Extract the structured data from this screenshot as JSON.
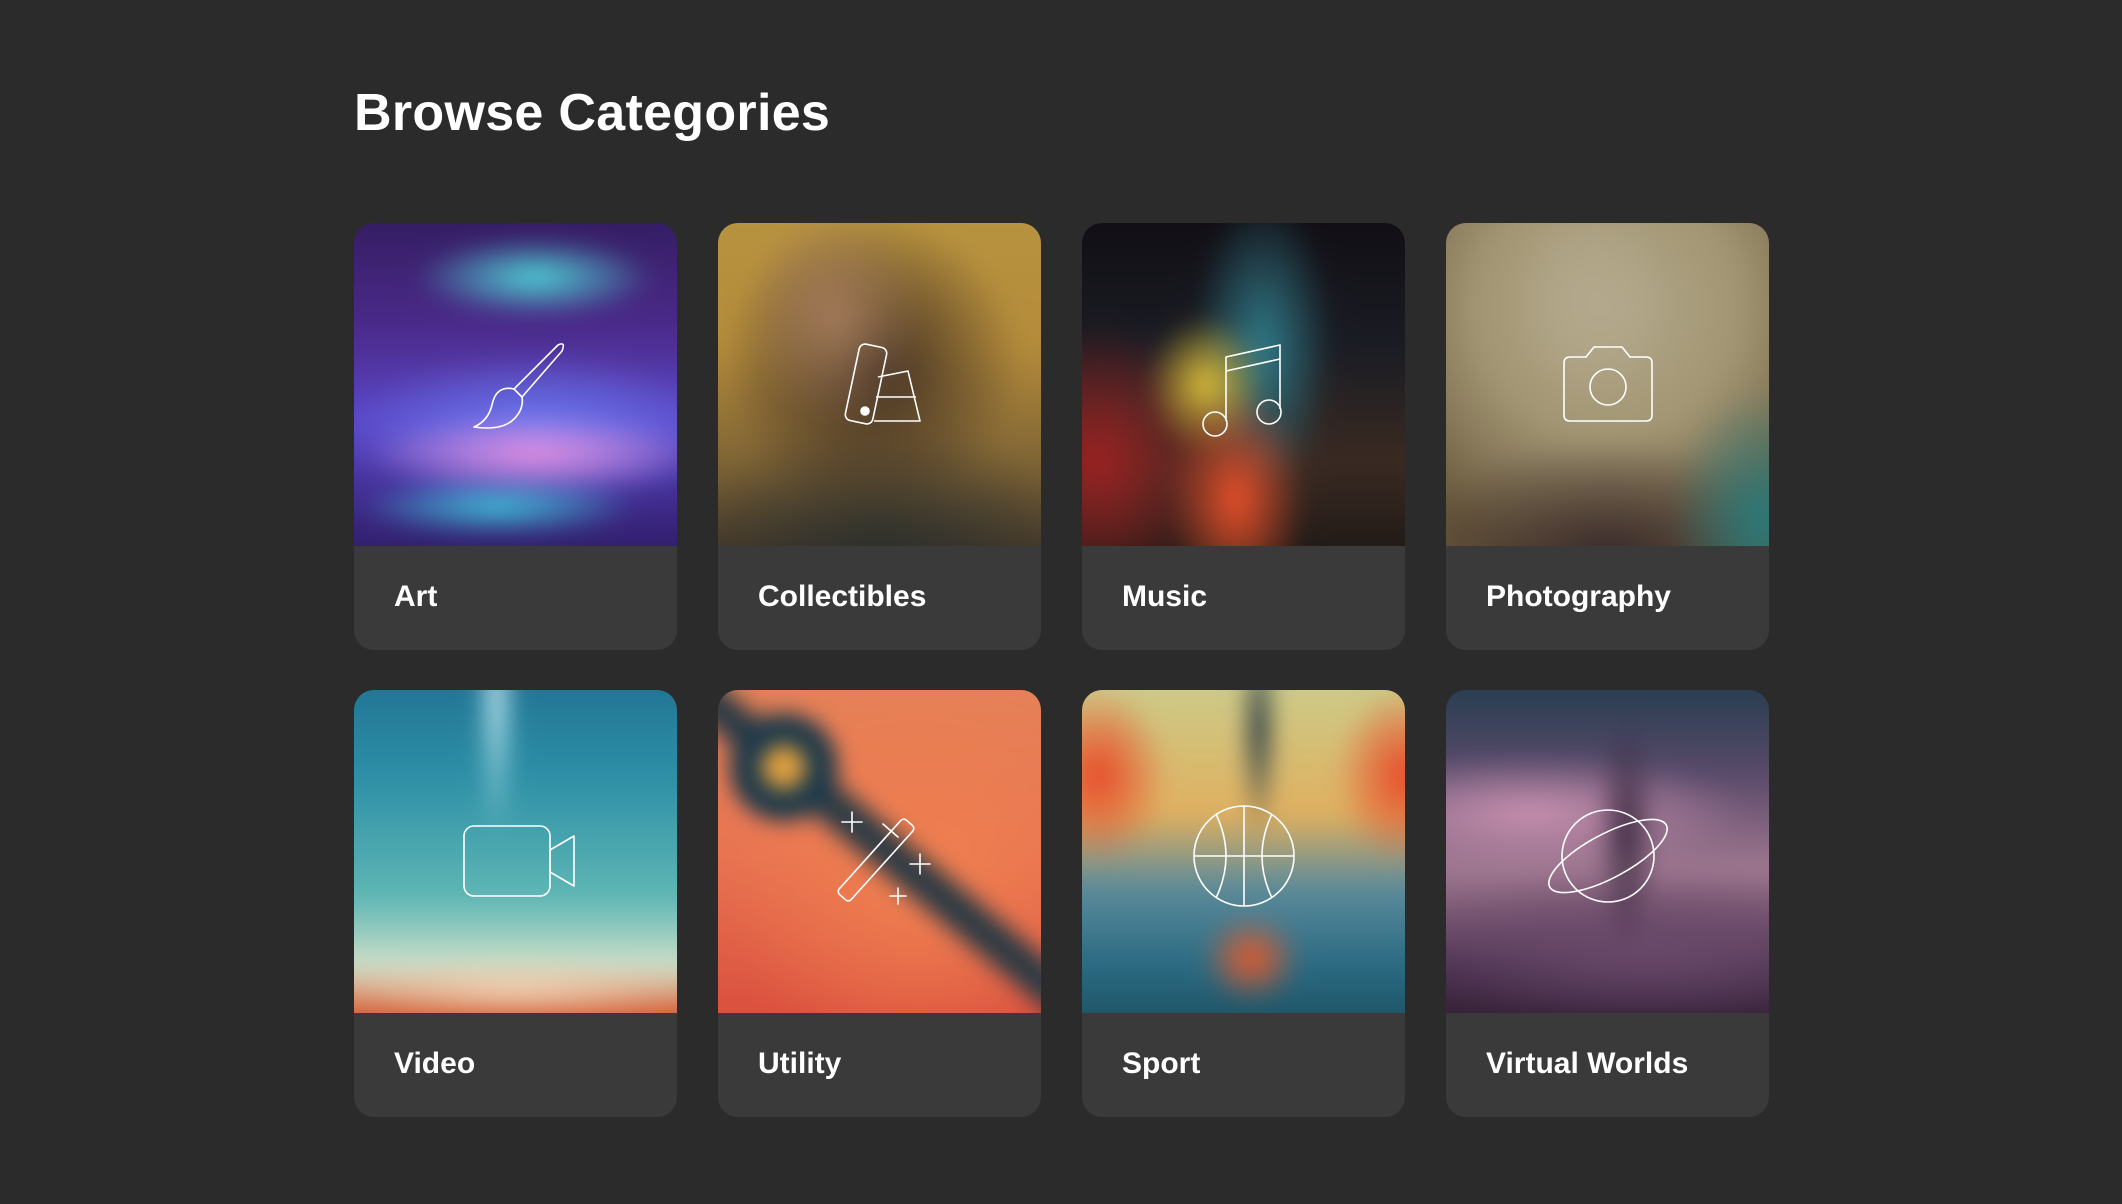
{
  "page": {
    "title": "Browse Categories"
  },
  "categories": [
    {
      "label": "Art",
      "icon": "paintbrush-icon"
    },
    {
      "label": "Collectibles",
      "icon": "swatch-cards-icon"
    },
    {
      "label": "Music",
      "icon": "music-note-icon"
    },
    {
      "label": "Photography",
      "icon": "camera-icon"
    },
    {
      "label": "Video",
      "icon": "video-camera-icon"
    },
    {
      "label": "Utility",
      "icon": "magic-wand-icon"
    },
    {
      "label": "Sport",
      "icon": "basketball-icon"
    },
    {
      "label": "Virtual Worlds",
      "icon": "planet-icon"
    }
  ],
  "colors": {
    "page_background": "#2b2b2b",
    "card_background": "#3a3a3a",
    "text": "#ffffff",
    "icon_stroke": "#ffffff"
  }
}
